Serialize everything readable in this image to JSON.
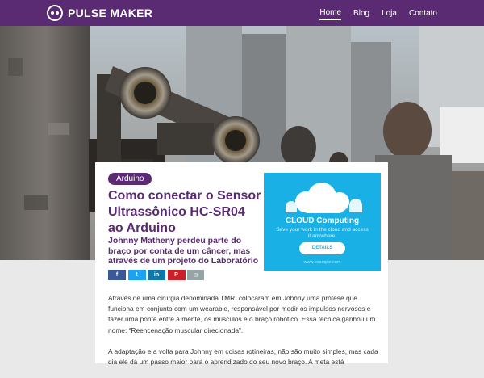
{
  "site": {
    "name": "PULSE MAKER",
    "logo_icon": "robot-face-icon"
  },
  "nav": {
    "items": [
      {
        "label": "Home",
        "active": true
      },
      {
        "label": "Blog",
        "active": false
      },
      {
        "label": "Loja",
        "active": false
      },
      {
        "label": "Contato",
        "active": false
      }
    ]
  },
  "article": {
    "category": "Arduino",
    "title": "Como conectar o Sensor Ultrassônico HC-SR04 ao Arduino",
    "subtitle": "Johnny Matheny perdeu parte do braço por conta de um câncer, mas através de um projeto do Laboratório",
    "share": [
      {
        "network": "facebook",
        "icon": "facebook-icon",
        "glyph": "f",
        "color": "#3b5998"
      },
      {
        "network": "twitter",
        "icon": "twitter-icon",
        "glyph": "t",
        "color": "#1da1f2"
      },
      {
        "network": "linkedin",
        "icon": "linkedin-icon",
        "glyph": "in",
        "color": "#0e76a8"
      },
      {
        "network": "pinterest",
        "icon": "pinterest-icon",
        "glyph": "P",
        "color": "#cb2027"
      },
      {
        "network": "email",
        "icon": "email-icon",
        "glyph": "✉",
        "color": "#95a5a6"
      }
    ],
    "paragraphs": [
      "Através de uma cirurgia denominada TMR, colocaram em Johnny uma prótese que funciona em conjunto com um wearable, responsável por medir os impulsos nervosos e fazer uma ponte entre a mente, os músculos e o braço robótico. Essa técnica ganhou um nome: “Reencenação muscular direcionada”.",
      "A adaptação e a volta para Johnny em coisas rotineiras, não são muito simples, mas cada dia ele dá um passo maior para o aprendizado do seu novo braço. A meta está"
    ]
  },
  "ad": {
    "title": "CLOUD Computing",
    "subtitle": "Save your work in the cloud and access it anywhere.",
    "button": "DETAILS",
    "url": "www.example.com",
    "icon": "cloud-icon"
  },
  "colors": {
    "brand": "#5a2a73",
    "ad": "#19b0e6",
    "page_bg": "#e9e9e9"
  }
}
